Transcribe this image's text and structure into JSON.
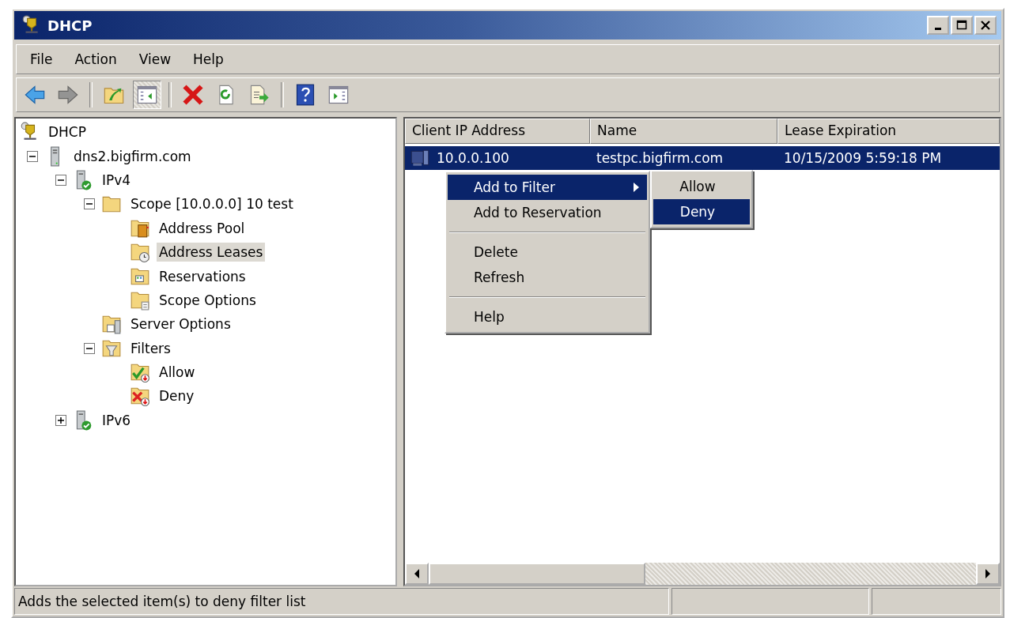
{
  "window": {
    "title": "DHCP"
  },
  "menu_bar": [
    "File",
    "Action",
    "View",
    "Help"
  ],
  "toolbar": [
    {
      "kind": "back",
      "disabled": false,
      "pressed": false
    },
    {
      "kind": "forward",
      "disabled": true,
      "pressed": false
    },
    {
      "kind": "separator"
    },
    {
      "kind": "up",
      "disabled": false,
      "pressed": false
    },
    {
      "kind": "tree",
      "disabled": false,
      "pressed": true
    },
    {
      "kind": "separator"
    },
    {
      "kind": "delete",
      "disabled": false,
      "pressed": false
    },
    {
      "kind": "refresh",
      "disabled": false,
      "pressed": false
    },
    {
      "kind": "export",
      "disabled": false,
      "pressed": false
    },
    {
      "kind": "separator"
    },
    {
      "kind": "help",
      "disabled": false,
      "pressed": false
    },
    {
      "kind": "pane",
      "disabled": false,
      "pressed": false
    }
  ],
  "tree": [
    {
      "label": "DHCP",
      "kind": "root",
      "selected": false,
      "children": [
        {
          "label": "dns2.bigfirm.com",
          "kind": "server",
          "expanded": true,
          "selected": false,
          "children": [
            {
              "label": "IPv4",
              "kind": "protocol",
              "expanded": true,
              "selected": false,
              "children": [
                {
                  "label": "Scope [10.0.0.0] 10 test",
                  "kind": "scope",
                  "expanded": true,
                  "selected": false,
                  "children": [
                    {
                      "label": "Address Pool",
                      "kind": "pool",
                      "selected": false
                    },
                    {
                      "label": "Address Leases",
                      "kind": "leases",
                      "selected": true
                    },
                    {
                      "label": "Reservations",
                      "kind": "reservations",
                      "selected": false
                    },
                    {
                      "label": "Scope Options",
                      "kind": "scopeoptions",
                      "selected": false
                    }
                  ]
                },
                {
                  "label": "Server Options",
                  "kind": "serveroptions",
                  "selected": false
                },
                {
                  "label": "Filters",
                  "kind": "filter",
                  "expanded": true,
                  "selected": false,
                  "children": [
                    {
                      "label": "Allow",
                      "kind": "allow",
                      "selected": false
                    },
                    {
                      "label": "Deny",
                      "kind": "deny",
                      "selected": false
                    }
                  ]
                }
              ]
            },
            {
              "label": "IPv6",
              "kind": "protocol",
              "expanded": false,
              "selected": false
            }
          ]
        }
      ]
    }
  ],
  "list": {
    "columns": [
      "Client IP Address",
      "Name",
      "Lease Expiration"
    ],
    "rows": [
      {
        "cells": [
          "10.0.0.100",
          "testpc.bigfirm.com",
          "10/15/2009 5:59:18 PM"
        ],
        "selected": true
      }
    ]
  },
  "context_menu": {
    "items": [
      {
        "kind": "item",
        "label": "Add to Filter",
        "submenu": true,
        "selected": true
      },
      {
        "kind": "item",
        "label": "Add to Reservation",
        "submenu": false,
        "selected": false
      },
      {
        "kind": "separator"
      },
      {
        "kind": "item",
        "label": "Delete",
        "submenu": false,
        "selected": false
      },
      {
        "kind": "item",
        "label": "Refresh",
        "submenu": false,
        "selected": false
      },
      {
        "kind": "separator"
      },
      {
        "kind": "item",
        "label": "Help",
        "submenu": false,
        "selected": false
      }
    ],
    "submenu": [
      {
        "label": "Allow",
        "selected": false
      },
      {
        "label": "Deny",
        "selected": true
      }
    ]
  },
  "status_bar": {
    "text": "Adds the selected item(s) to deny filter list"
  }
}
